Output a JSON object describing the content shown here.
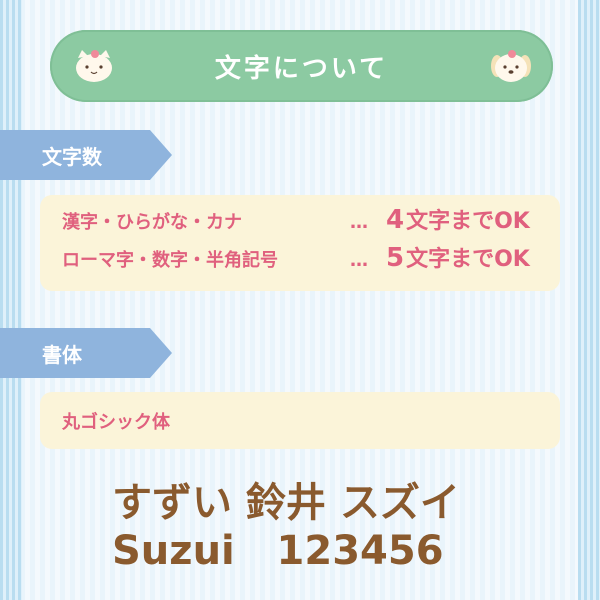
{
  "header": {
    "title": "文字について",
    "left_icon": "cat-mascot-icon",
    "right_icon": "dog-mascot-icon"
  },
  "char_count": {
    "tag": "文字数",
    "rows": [
      {
        "label": "漢字・ひらがな・カナ",
        "dots": "…",
        "number": "4",
        "suffix": "文字までOK"
      },
      {
        "label": "ローマ字・数字・半角記号",
        "dots": "…",
        "number": "5",
        "suffix": "文字までOK"
      }
    ]
  },
  "typeface": {
    "tag": "書体",
    "name": "丸ゴシック体"
  },
  "sample": {
    "line1": "すずい 鈴井 スズイ",
    "line2": "Suzui   123456"
  },
  "colors": {
    "header": "#8ccaa2",
    "tag": "#8fb4dd",
    "panel": "#fbf4d9",
    "accent_text": "#e0607e",
    "sample_text": "#8a5a2e"
  }
}
